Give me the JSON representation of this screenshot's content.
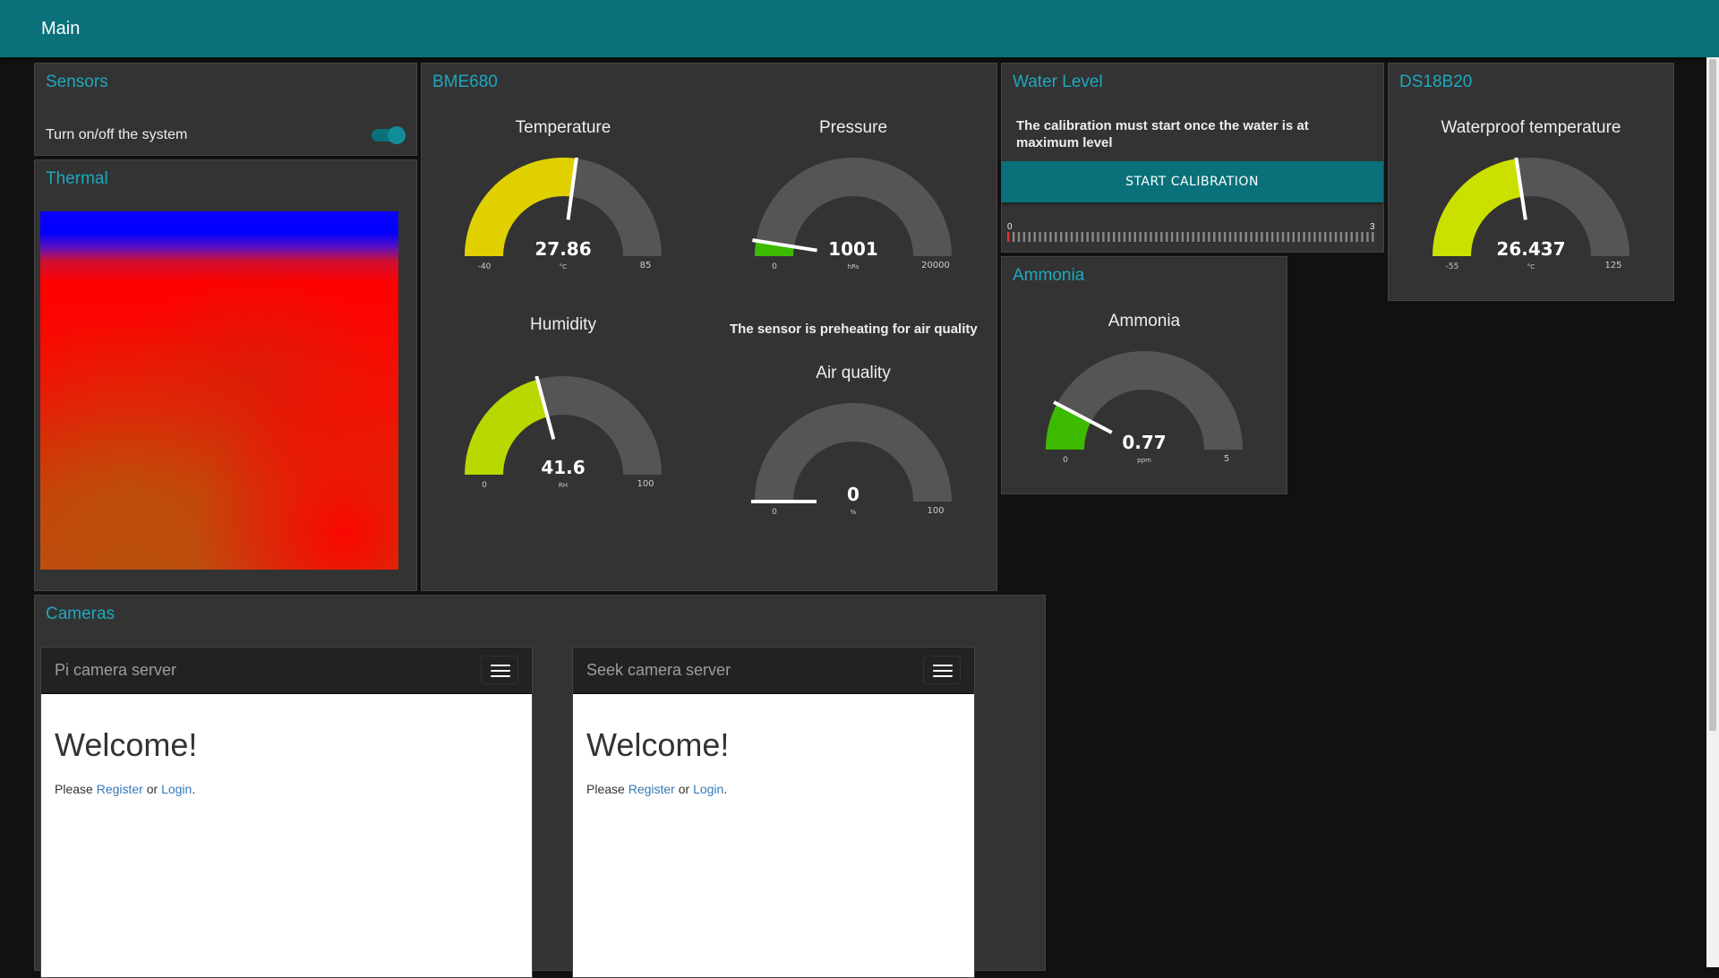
{
  "header": {
    "title": "Main"
  },
  "sensors": {
    "title": "Sensors",
    "toggle_label": "Turn on/off the system",
    "toggle_on": true
  },
  "thermal": {
    "title": "Thermal"
  },
  "bme680": {
    "title": "BME680",
    "preheat_msg": "The sensor is preheating for air quality",
    "gauges": {
      "temperature": {
        "title": "Temperature",
        "value": "27.86",
        "unit": "°C",
        "min": "-40",
        "max": "85",
        "fill_color": "#e0d000"
      },
      "pressure": {
        "title": "Pressure",
        "value": "1001",
        "unit": "hPa",
        "min": "0",
        "max": "20000",
        "fill_color": "#3cba00"
      },
      "humidity": {
        "title": "Humidity",
        "value": "41.6",
        "unit": "RH",
        "min": "0",
        "max": "100",
        "fill_color": "#b8d800"
      },
      "air_quality": {
        "title": "Air quality",
        "value": "0",
        "unit": "%",
        "min": "0",
        "max": "100",
        "fill_color": "#3cba00"
      }
    }
  },
  "water_level": {
    "title": "Water Level",
    "message": "The calibration must start once the water is at maximum level",
    "button_label": "START CALIBRATION",
    "slider_min": "0",
    "slider_max": "3",
    "slider_value": 0
  },
  "ds18b20": {
    "title": "DS18B20",
    "gauge": {
      "title": "Waterproof temperature",
      "value": "26.437",
      "unit": "°C",
      "min": "-55",
      "max": "125",
      "fill_color": "#cce000"
    }
  },
  "ammonia": {
    "title": "Ammonia",
    "gauge": {
      "title": "Ammonia",
      "value": "0.77",
      "unit": "ppm",
      "min": "0",
      "max": "5",
      "fill_color": "#3cba00"
    }
  },
  "cameras": {
    "title": "Cameras",
    "frames": [
      {
        "brand": "Pi camera server",
        "welcome": "Welcome!",
        "please": "Please",
        "register": "Register",
        "or": "or",
        "login": "Login",
        "end": "."
      },
      {
        "brand": "Seek camera server",
        "welcome": "Welcome!",
        "please": "Please",
        "register": "Register",
        "or": "or",
        "login": "Login",
        "end": "."
      }
    ]
  },
  "colors": {
    "accent": "#0a7079",
    "title_text": "#1ea8bf",
    "card_bg": "#333333",
    "page_bg": "#111111",
    "gauge_track": "#555555"
  }
}
